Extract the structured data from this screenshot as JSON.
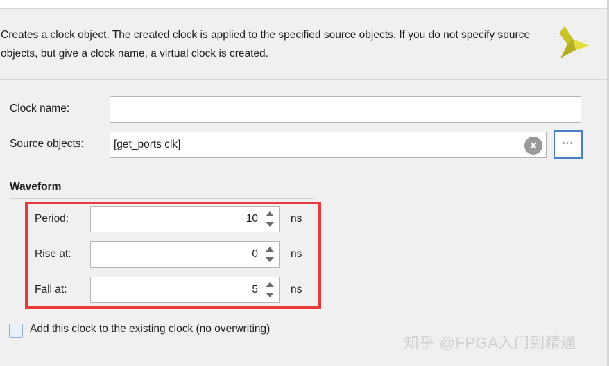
{
  "header": {
    "description": "Creates a clock object. The created clock is applied to the specified source objects. If you do not specify source objects, but give a clock name, a virtual clock is created."
  },
  "clock_name": {
    "label": "Clock name:",
    "value": ""
  },
  "source_objects": {
    "label": "Source objects:",
    "value": "[get_ports clk]",
    "browse_label": "···"
  },
  "waveform": {
    "title": "Waveform",
    "period": {
      "label": "Period:",
      "value": "10",
      "unit": "ns"
    },
    "rise_at": {
      "label": "Rise at:",
      "value": "0",
      "unit": "ns"
    },
    "fall_at": {
      "label": "Fall at:",
      "value": "5",
      "unit": "ns"
    }
  },
  "add_existing": {
    "label": "Add this clock to the existing clock (no overwriting)",
    "checked": false
  },
  "watermark": "知乎 @FPGA入门到精通",
  "colors": {
    "highlight": "#e83a3a",
    "browse_border": "#4a7fc9",
    "logo": "#d8d12a"
  }
}
